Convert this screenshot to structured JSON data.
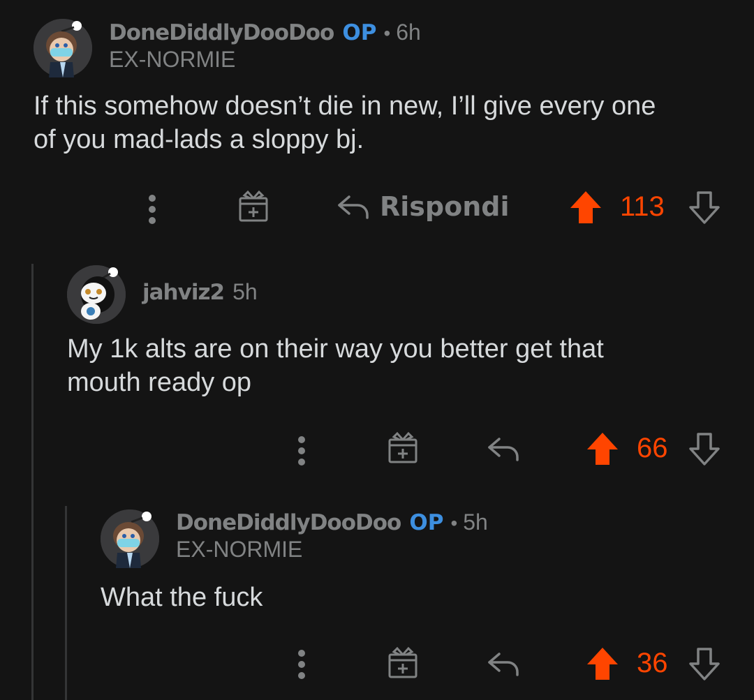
{
  "comments": [
    {
      "username": "DoneDiddlyDooDoo",
      "op_label": "OP",
      "age": "6h",
      "flair": "EX-NORMIE",
      "body_line1": "If this somehow doesn’t die in new, I’ll give every one",
      "body_line2": "of you mad-lads a sloppy bj.",
      "reply_label": "Rispondi",
      "score": "113"
    },
    {
      "username": "jahviz2",
      "age": "5h",
      "body_line1": "My 1k alts are on their way you better get that",
      "body_line2": "mouth ready op",
      "score": "66"
    },
    {
      "username": "DoneDiddlyDooDoo",
      "op_label": "OP",
      "age": "5h",
      "flair": "EX-NORMIE",
      "body_line1": "What the fuck",
      "score": "36"
    }
  ],
  "colors": {
    "background": "#141414",
    "upvote": "#ff4500",
    "op_badge": "#3d8fe0",
    "muted": "#818384",
    "text": "#d7dadc",
    "thread_line": "#343536"
  },
  "icons": [
    "more-options-icon",
    "award-icon",
    "reply-icon",
    "upvote-icon",
    "downvote-icon",
    "avatar-icon"
  ]
}
